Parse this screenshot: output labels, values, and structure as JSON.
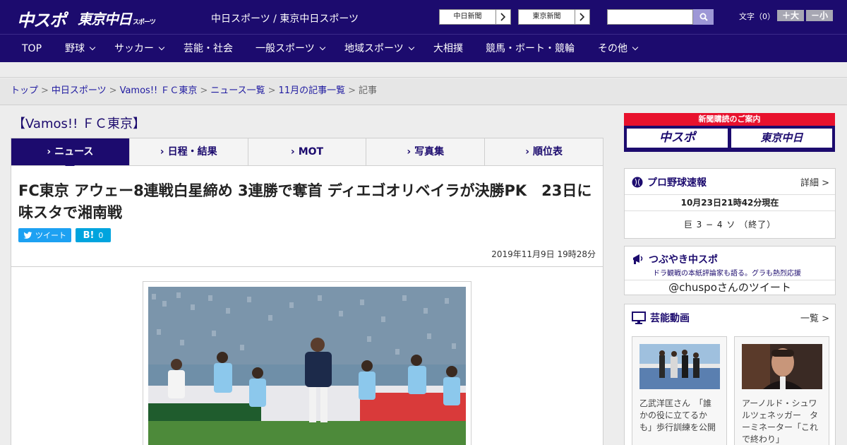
{
  "header": {
    "logo_chuspo": "中スポ",
    "logo_tokyo": "東京中日",
    "logo_tokyo_sub": "スポーツ",
    "site_names": "中日スポーツ / 東京中日スポーツ",
    "link_chunichi": "中日新聞",
    "link_tokyo": "東京新聞",
    "font_size_label": "文字（0）",
    "font_larger": "＋大",
    "font_smaller": "－小"
  },
  "nav": {
    "items": [
      "TOP",
      "野球",
      "サッカー",
      "芸能・社会",
      "一般スポーツ",
      "地域スポーツ",
      "大相撲",
      "競馬・ボート・競輪",
      "その他"
    ]
  },
  "breadcrumb": {
    "items": [
      "トップ",
      "中日スポーツ",
      "Vamos!! ＦＣ東京",
      "ニュース一覧",
      "11月の記事一覧"
    ],
    "current": "記事",
    "sep": ">"
  },
  "section": {
    "title": "【Vamos!! ＦＣ東京】"
  },
  "tabs": [
    "ニュース",
    "日程・結果",
    "MOT",
    "写真集",
    "順位表"
  ],
  "article": {
    "headline": "FC東京 アウェー8連戦白星締め 3連勝で奪首 ディエゴオリベイラが決勝PK　23日に味スタで湘南戦",
    "tweet_label": "ツイート",
    "hatena_label": "B!",
    "hatena_count": "0",
    "date": "2019年11月9日 19時28分"
  },
  "sidebar": {
    "subscribe_label": "新聞購読のご案内",
    "subscribe_logo_1": "中スポ",
    "subscribe_logo_2": "東京中日",
    "baseball": {
      "title": "プロ野球速報",
      "more": "詳細 >",
      "time": "10月23日21時42分現在",
      "score": "巨 3 − 4 ソ （終了）"
    },
    "tsubuyaki": {
      "title": "つぶやき中スポ",
      "subtitle": "ドラ観戦の本紙評論家も語る。グラも熱烈応援",
      "tweets": "@chuspoさんのツイート"
    },
    "geino": {
      "title": "芸能動画",
      "more": "一覧 >",
      "videos": [
        {
          "caption": "乙武洋匡さん　「誰かの役に立てるかも」歩行訓練を公開"
        },
        {
          "caption": "アーノルド・シュワルツェネッガー　ターミネーター「これで終わり」"
        }
      ]
    }
  },
  "colors": {
    "brand_navy": "#1c0b6e",
    "subscribe_red": "#e8112d",
    "twitter_blue": "#1da1f2",
    "hatena_blue": "#00a4de"
  }
}
